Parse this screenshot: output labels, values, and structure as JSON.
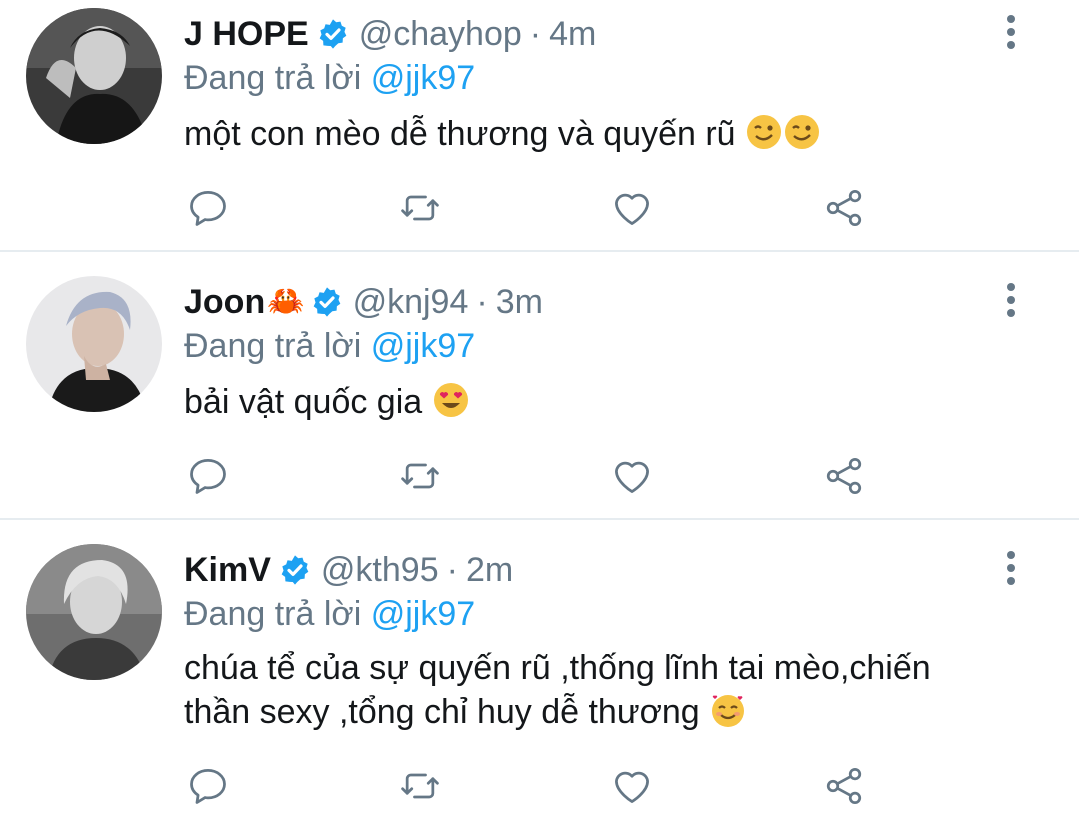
{
  "colors": {
    "text": "#14171a",
    "muted": "#657786",
    "accent": "#1da1f2",
    "divider": "#e6ecf0",
    "icon": "#657786"
  },
  "tweets": [
    {
      "name": "J HOPE",
      "name_suffix": "",
      "verified": true,
      "handle": "@chayhop",
      "time": "4m",
      "reply_prefix": "Đang trả lời",
      "reply_to": "@jjk97",
      "text_lines": [
        "một con mèo dễ thương và quyến rũ"
      ],
      "emojis": [
        "winking-face",
        "winking-face"
      ],
      "actions": [
        "reply-icon",
        "retweet-icon",
        "like-icon",
        "share-icon"
      ]
    },
    {
      "name": "Joon",
      "name_suffix": "🦀",
      "verified": true,
      "handle": "@knj94",
      "time": "3m",
      "reply_prefix": "Đang trả lời",
      "reply_to": "@jjk97",
      "text_lines": [
        "bải vật quốc gia"
      ],
      "emojis": [
        "heart-eyes-face"
      ],
      "actions": [
        "reply-icon",
        "retweet-icon",
        "like-icon",
        "share-icon"
      ]
    },
    {
      "name": "KimV",
      "name_suffix": "",
      "verified": true,
      "handle": "@kth95",
      "time": "2m",
      "reply_prefix": "Đang trả lời",
      "reply_to": "@jjk97",
      "text_lines": [
        "chúa tể của sự quyến rũ ,thống lĩnh tai mèo,chiến",
        "thần sexy ,tổng chỉ huy dễ thương"
      ],
      "emojis": [
        "smiling-face-with-hearts"
      ],
      "actions": [
        "reply-icon",
        "retweet-icon",
        "like-icon",
        "share-icon"
      ]
    }
  ]
}
